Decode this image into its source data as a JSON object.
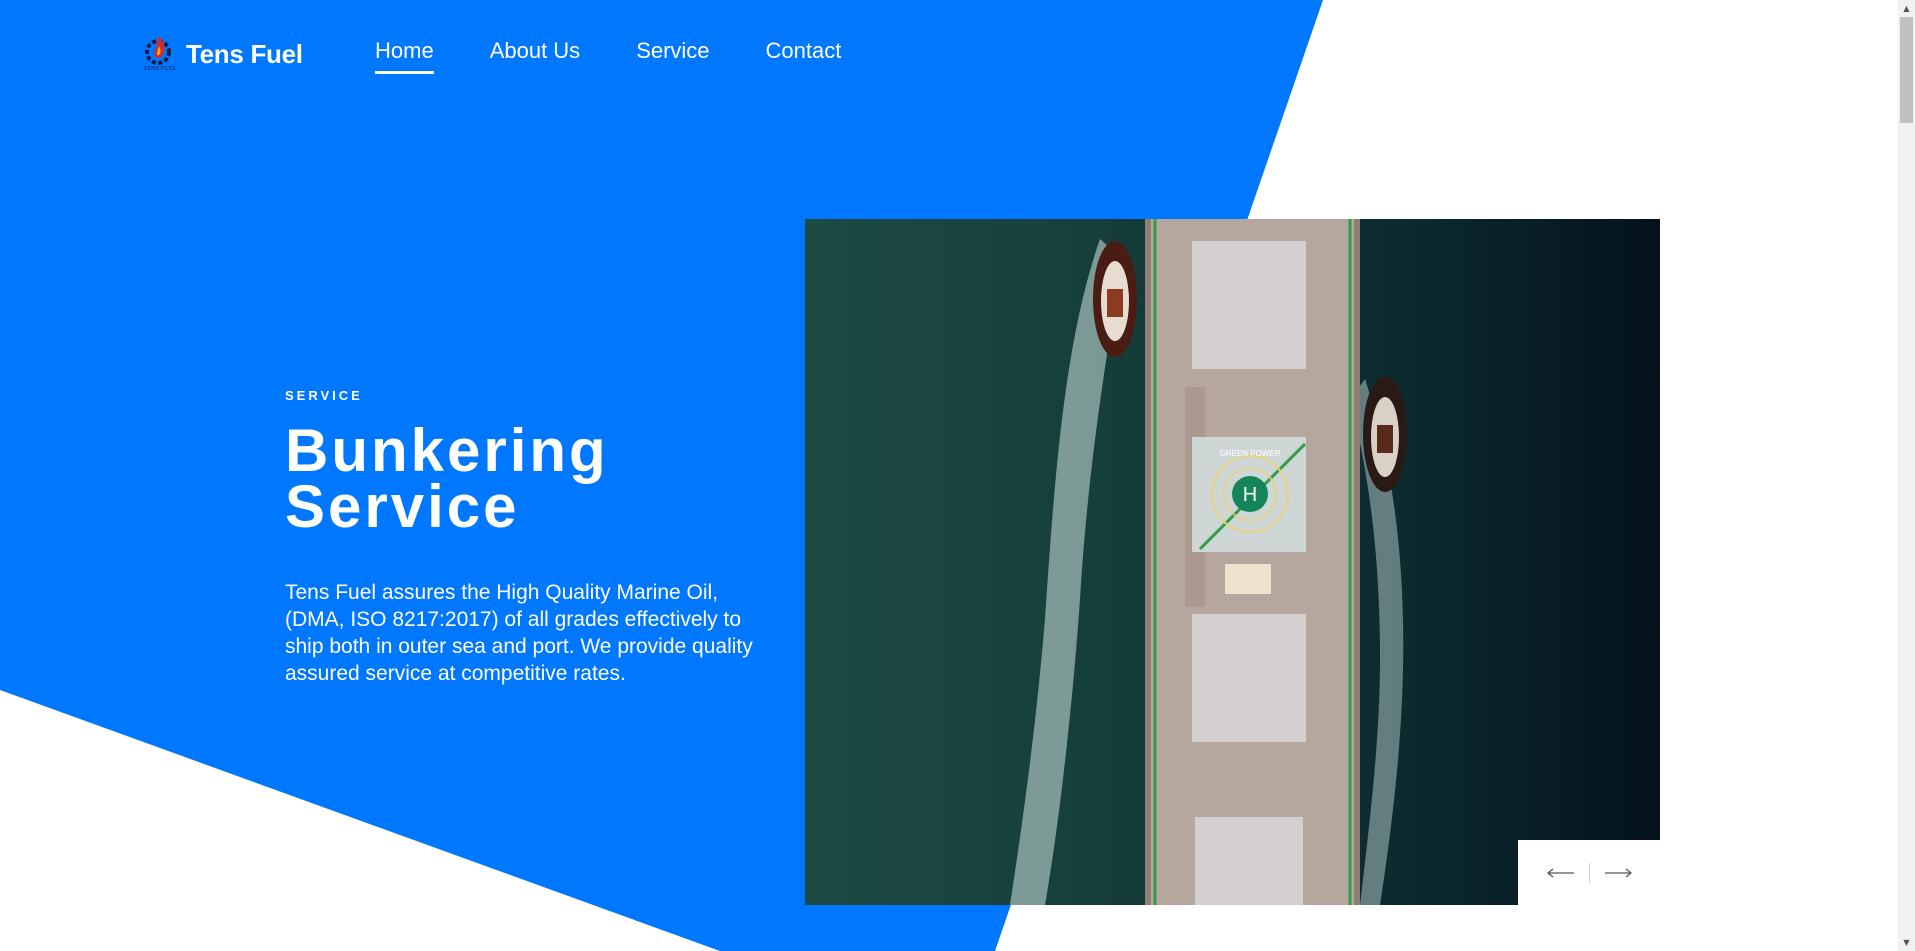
{
  "colors": {
    "brand_blue": "#0077ff",
    "white": "#ffffff",
    "logo_red": "#d42a2a",
    "logo_dark": "#1a1a40"
  },
  "brand": {
    "name": "Tens Fuel",
    "logo_caption": "TENS FUEL",
    "logo_icon": "flame-gear-icon"
  },
  "nav": {
    "items": [
      {
        "label": "Home",
        "active": true
      },
      {
        "label": "About Us",
        "active": false
      },
      {
        "label": "Service",
        "active": false
      },
      {
        "label": "Contact",
        "active": false
      }
    ]
  },
  "hero": {
    "eyebrow": "SERVICE",
    "title_line1": "Bunkering",
    "title_line2": "Service",
    "description": "Tens Fuel assures the High Quality Marine Oil, (DMA, ISO 8217:2017) of all grades effectively to ship both in outer sea and port. We provide quality assured service at competitive rates.",
    "image_alt": "Aerial view of a cargo ship with two tugboats",
    "helipad_letter": "H",
    "helipad_text": "GREEN POWER"
  },
  "slider": {
    "prev_icon": "arrow-left-icon",
    "next_icon": "arrow-right-icon"
  },
  "scrollbar": {
    "up_icon": "scroll-up-icon",
    "down_icon": "scroll-down-icon"
  }
}
